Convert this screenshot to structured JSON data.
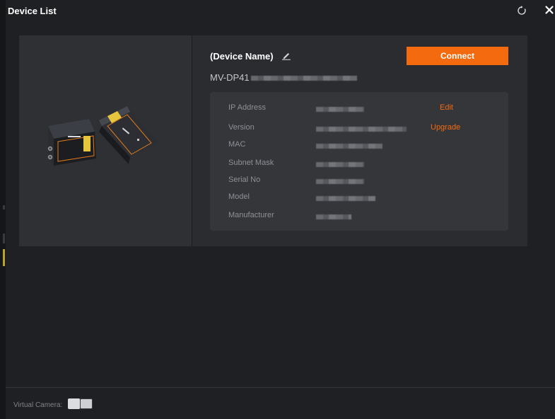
{
  "window": {
    "title": "Device List",
    "refresh_icon": "refresh-icon",
    "close_icon": "close-icon"
  },
  "device": {
    "name": "(Device Name)",
    "model_prefix": "MV-DP41",
    "connect_label": "Connect",
    "edit_icon": "pencil-icon"
  },
  "info": {
    "rows": [
      {
        "label": "IP Address",
        "action": "Edit"
      },
      {
        "label": "Version",
        "action": "Upgrade"
      },
      {
        "label": "MAC",
        "action": ""
      },
      {
        "label": "Subnet Mask",
        "action": ""
      },
      {
        "label": "Serial No",
        "action": ""
      },
      {
        "label": "Model",
        "action": ""
      },
      {
        "label": "Manufacturer",
        "action": ""
      }
    ]
  },
  "footer": {
    "virtual_camera_label": "Virtual Camera:",
    "virtual_camera_enabled": false
  },
  "colors": {
    "accent": "#f46a0f",
    "background": "#1f2023",
    "card": "#2b2c30",
    "panel": "#34363a"
  }
}
